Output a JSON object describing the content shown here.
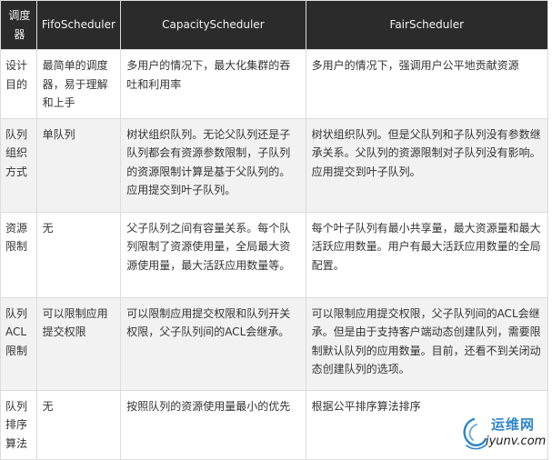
{
  "table": {
    "headers": [
      "调度器",
      "FifoScheduler",
      "CapacityScheduler",
      "FairScheduler"
    ],
    "rows": [
      [
        "设计目的",
        "最简单的调度器，易于理解和上手",
        "多用户的情况下，最大化集群的吞吐和利用率",
        "多用户的情况下，强调用户公平地贡献资源"
      ],
      [
        "队列组织方式",
        "单队列",
        "树状组织队列。无论父队列还是子队列都会有资源参数限制，子队列的资源限制计算是基于父队列的。应用提交到叶子队列。",
        "树状组织队列。但是父队列和子队列没有参数继承关系。父队列的资源限制对子队列没有影响。应用提交到叶子队列。"
      ],
      [
        "资源限制",
        "无",
        "父子队列之间有容量关系。每个队列限制了资源使用量，全局最大资源使用量，最大活跃应用数量等。",
        "每个叶子队列有最小共享量，最大资源量和最大活跃应用数量。用户有最大活跃应用数量的全局配置。"
      ],
      [
        "队列ACL限制",
        "可以限制应用提交权限",
        "可以限制应用提交权限和队列开关权限，父子队列间的ACL会继承。",
        "可以限制应用提交权限，父子队列间的ACL会继承。但是由于支持客户端动态创建队列，需要限制默认队列的应用数量。目前，还看不到关闭动态创建队列的选项。"
      ],
      [
        "队列排序算法",
        "无",
        "按照队列的资源使用量最小的优先",
        "根据公平排序算法排序"
      ]
    ]
  },
  "watermark": {
    "name": "运维网",
    "url": "iyunv.com",
    "icon": "swirl-logo-icon",
    "color": "#2f86c8"
  }
}
